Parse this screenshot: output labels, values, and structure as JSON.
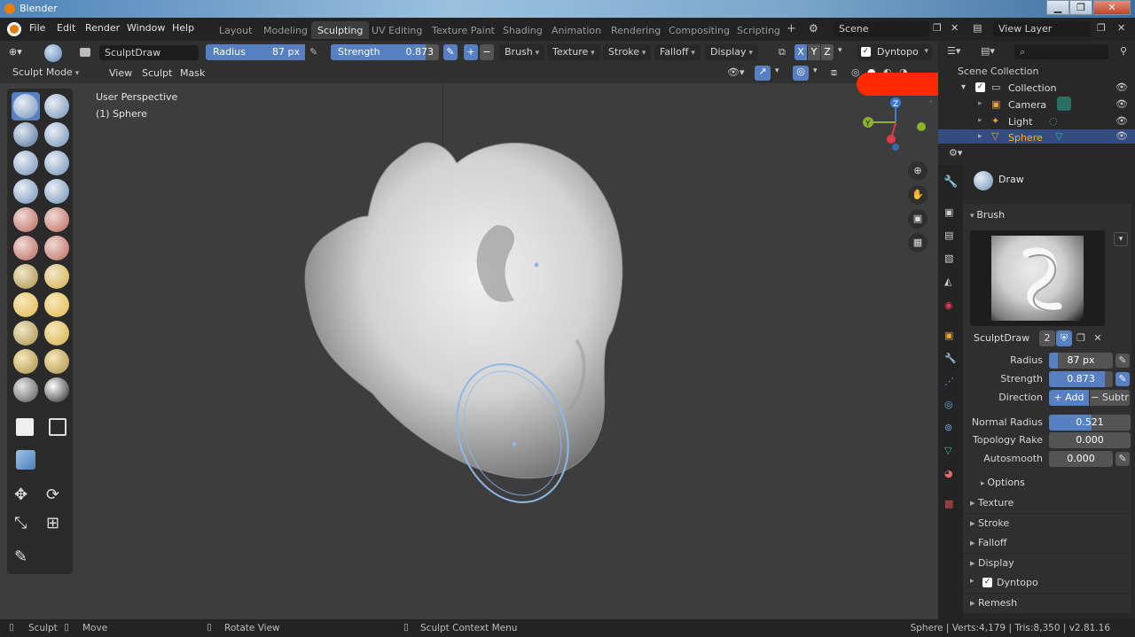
{
  "window": {
    "title": "Blender",
    "minimize": "▁",
    "maximize": "❐",
    "close": "✕"
  },
  "menu": [
    "File",
    "Edit",
    "Render",
    "Window",
    "Help"
  ],
  "workspaces": [
    "Layout",
    "Modeling",
    "Sculpting",
    "UV Editing",
    "Texture Paint",
    "Shading",
    "Animation",
    "Rendering",
    "Compositing",
    "Scripting"
  ],
  "active_workspace": "Sculpting",
  "add_workspace": "+",
  "scene": {
    "value": "Scene"
  },
  "view_layer": {
    "value": "View Layer"
  },
  "header": {
    "brush_name": "SculptDraw",
    "radius_label": "Radius",
    "radius_value": "87 px",
    "strength_label": "Strength",
    "strength_value": "0.873",
    "strength_fraction": 0.873,
    "plus": "+",
    "minus": "−",
    "brush_dd": "Brush",
    "texture_dd": "Texture",
    "stroke_dd": "Stroke",
    "falloff_dd": "Falloff",
    "display_dd": "Display",
    "axis_x": "X",
    "axis_y": "Y",
    "axis_z": "Z",
    "dyntopo": "Dyntopo"
  },
  "header2": {
    "mode": "Sculpt Mode",
    "view": "View",
    "sculpt": "Sculpt",
    "mask": "Mask"
  },
  "viewport": {
    "perspective": "User Perspective",
    "object": "(1) Sphere"
  },
  "gizmo": {
    "x": "X",
    "y": "Y",
    "z": "Z"
  },
  "outliner": {
    "root": "Scene Collection",
    "collection": "Collection",
    "items": [
      {
        "name": "Camera",
        "selected": false
      },
      {
        "name": "Light",
        "selected": false
      },
      {
        "name": "Sphere",
        "selected": true
      }
    ]
  },
  "properties": {
    "tool_name": "Draw",
    "brush_section": "Brush",
    "brush_datablock": "SculptDraw",
    "users": "2",
    "radius_label": "Radius",
    "radius_value": "87 px",
    "strength_label": "Strength",
    "strength_value": "0.873",
    "direction_label": "Direction",
    "dir_add": "+ Add",
    "dir_sub": "− Subtr",
    "normal_radius_label": "Normal Radius",
    "normal_radius_value": "0.521",
    "normal_radius_fraction": 0.521,
    "topology_rake_label": "Topology Rake",
    "topology_rake_value": "0.000",
    "autosmooth_label": "Autosmooth",
    "autosmooth_value": "0.000",
    "options": "Options",
    "sections": [
      "Texture",
      "Stroke",
      "Falloff",
      "Display"
    ],
    "dyntopo_section": "Dyntopo",
    "remesh_section": "Remesh"
  },
  "status": {
    "sculpt": "Sculpt",
    "move": "Move",
    "rotate": "Rotate View",
    "context": "Sculpt Context Menu",
    "stats": "Sphere | Verts:4,179 | Tris:8,350 | v2.81.16"
  },
  "colors": {
    "accent": "#5680c2",
    "selection": "#334d80",
    "redaction": "#ff2a00",
    "brush_circle": "#8db8e8"
  }
}
